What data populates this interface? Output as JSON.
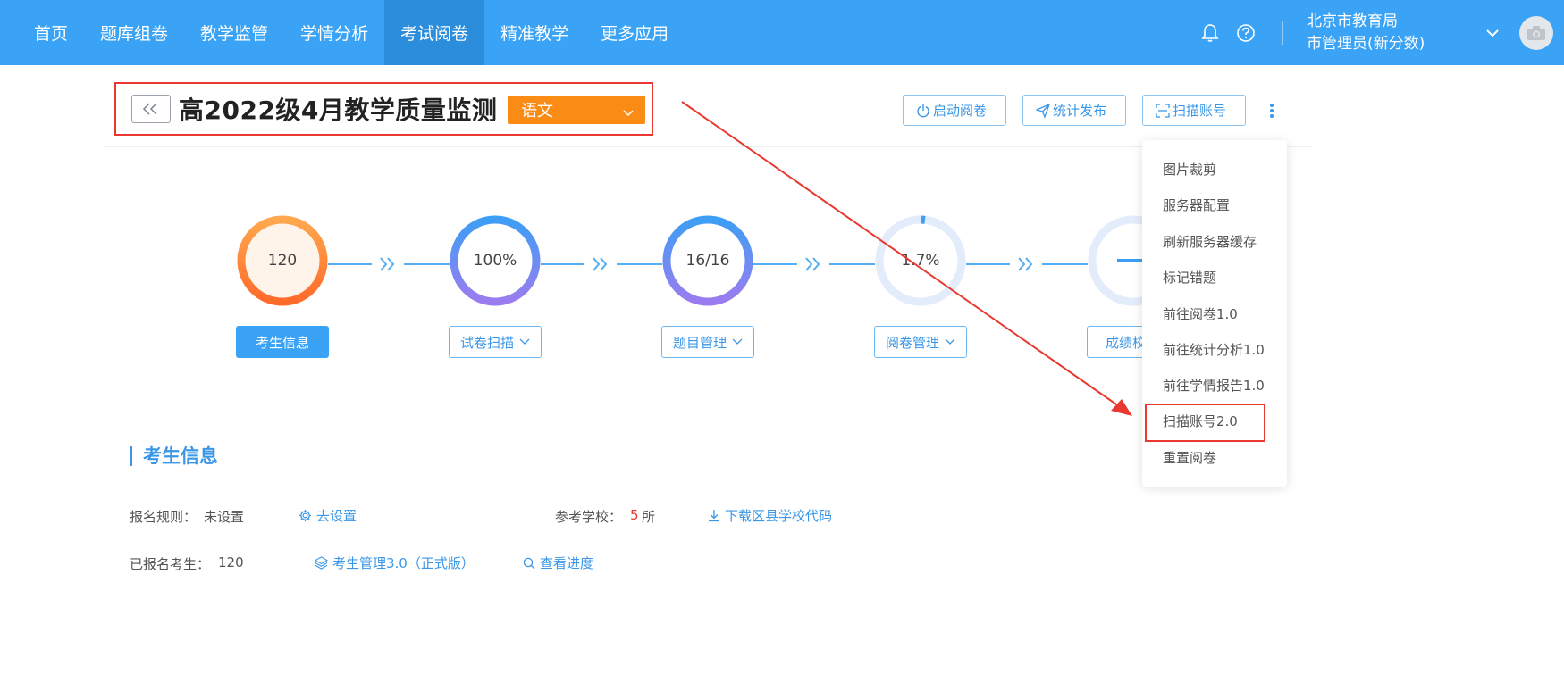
{
  "nav": {
    "items": [
      {
        "label": "首页",
        "active": false
      },
      {
        "label": "题库组卷",
        "active": false
      },
      {
        "label": "教学监管",
        "active": false
      },
      {
        "label": "学情分析",
        "active": false
      },
      {
        "label": "考试阅卷",
        "active": true
      },
      {
        "label": "精准教学",
        "active": false
      },
      {
        "label": "更多应用",
        "active": false
      }
    ],
    "user_line1": "北京市教育局",
    "user_line2": "市管理员(新分数)"
  },
  "exam": {
    "back_label": "<<",
    "title": "高2022级4月教学质量监测",
    "subject": "语文"
  },
  "toolbar": {
    "start_review": "启动阅卷",
    "publish_stats": "统计发布",
    "scan_account": "扫描账号"
  },
  "steps": [
    {
      "value": "120",
      "label": "考生信息",
      "progress": 100
    },
    {
      "value": "100%",
      "label": "试卷扫描",
      "progress": 100
    },
    {
      "value": "16/16",
      "label": "题目管理",
      "progress": 100
    },
    {
      "value": "1.7%",
      "label": "阅卷管理",
      "progress": 1.7
    },
    {
      "value": "",
      "label": "成绩校",
      "progress": 0
    }
  ],
  "menu": {
    "items": [
      "图片裁剪",
      "服务器配置",
      "刷新服务器缓存",
      "标记错题",
      "前往阅卷1.0",
      "前往统计分析1.0",
      "前往学情报告1.0",
      "扫描账号2.0",
      "重置阅卷"
    ],
    "highlighted": "扫描账号2.0"
  },
  "section": {
    "title": "考生信息",
    "rule_label": "报名规则：",
    "rule_value": "未设置",
    "go_setting": "去设置",
    "school_label": "参考学校：",
    "school_count": "5",
    "school_unit": "所",
    "download_codes": "下载区县学校代码",
    "registered_label": "已报名考生：",
    "registered_value": "120",
    "student_mgmt": "考生管理3.0（正式版）",
    "view_progress": "查看进度"
  },
  "colors": {
    "primary": "#3aa3f5",
    "accent_orange": "#fa8c16",
    "annotation_red": "#e8382f"
  }
}
